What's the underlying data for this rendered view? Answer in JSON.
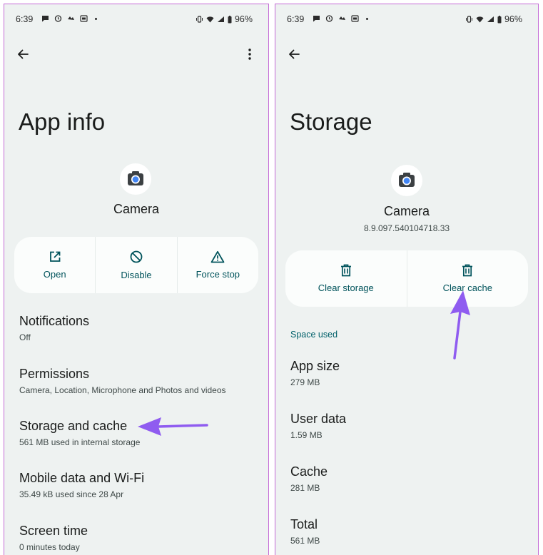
{
  "left": {
    "status": {
      "time": "6:39",
      "battery": "96%"
    },
    "title": "App info",
    "app_name": "Camera",
    "actions": [
      {
        "label": "Open",
        "icon": "open-external-icon"
      },
      {
        "label": "Disable",
        "icon": "disable-icon"
      },
      {
        "label": "Force stop",
        "icon": "warning-triangle-icon"
      }
    ],
    "items": [
      {
        "title": "Notifications",
        "sub": "Off"
      },
      {
        "title": "Permissions",
        "sub": "Camera, Location, Microphone and Photos and videos"
      },
      {
        "title": "Storage and cache",
        "sub": "561 MB used in internal storage"
      },
      {
        "title": "Mobile data and Wi-Fi",
        "sub": "35.49 kB used since 28 Apr"
      },
      {
        "title": "Screen time",
        "sub": "0 minutes today"
      }
    ]
  },
  "right": {
    "status": {
      "time": "6:39",
      "battery": "96%"
    },
    "title": "Storage",
    "app_name": "Camera",
    "app_version": "8.9.097.540104718.33",
    "actions": [
      {
        "label": "Clear storage",
        "icon": "trash-icon"
      },
      {
        "label": "Clear cache",
        "icon": "trash-icon"
      }
    ],
    "section_label": "Space used",
    "items": [
      {
        "title": "App size",
        "sub": "279 MB"
      },
      {
        "title": "User data",
        "sub": "1.59 MB"
      },
      {
        "title": "Cache",
        "sub": "281 MB"
      },
      {
        "title": "Total",
        "sub": "561 MB"
      }
    ]
  },
  "colors": {
    "screen_bg": "#eef2f1",
    "card_bg": "#fbfdfc",
    "accent": "#00535b",
    "annotation_arrow": "#8f5cf0",
    "frame_border": "#c46ad6"
  }
}
